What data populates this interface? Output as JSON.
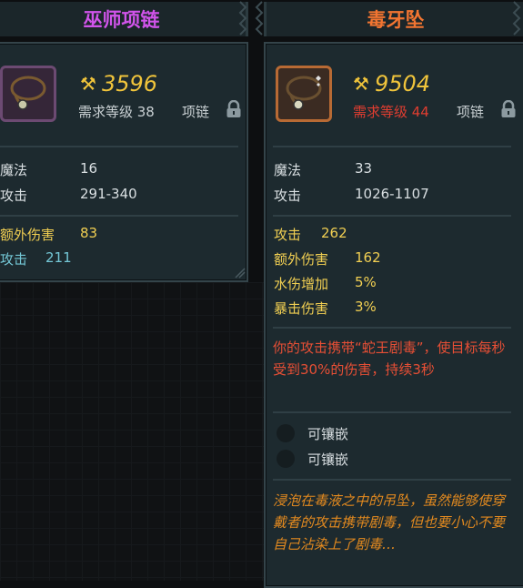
{
  "left_item": {
    "name": "巫师项链",
    "power": "3596",
    "requirement": "需求等级 38",
    "slot": "项链",
    "base_stats": [
      {
        "name": "魔法",
        "value": "16"
      },
      {
        "name": "攻击",
        "value": "291-340"
      }
    ],
    "bonus_stats": [
      {
        "name": "额外伤害",
        "value": "83",
        "color": "yellow"
      },
      {
        "name": "攻击",
        "value": "211",
        "color": "cyan"
      }
    ]
  },
  "right_item": {
    "name": "毒牙坠",
    "power": "9504",
    "requirement": "需求等级 44",
    "slot": "项链",
    "base_stats": [
      {
        "name": "魔法",
        "value": "33"
      },
      {
        "name": "攻击",
        "value": "1026-1107"
      }
    ],
    "bonus_stats": [
      {
        "name": "攻击",
        "value": "262"
      },
      {
        "name": "额外伤害",
        "value": "162"
      },
      {
        "name": "水伤增加",
        "value": "5%"
      },
      {
        "name": "暴击伤害",
        "value": "3%"
      }
    ],
    "effect": "你的攻击携带“蛇王剧毒”，使目标每秒受到30%的伤害，持续3秒",
    "sockets": [
      "可镶嵌",
      "可镶嵌"
    ],
    "flavor": "浸泡在毒液之中的吊坠，虽然能够使穿戴者的攻击携带剧毒，但也要小心不要自己沾染上了剧毒…"
  },
  "colors": {
    "left_title": "#d154ea",
    "right_title": "#f27531",
    "power": "#f0c43b",
    "requirement_unmet": "#e03d30",
    "bonus_yellow": "#f1cf52",
    "bonus_cyan": "#74c7d6",
    "effect": "#e84f35",
    "flavor": "#e38a1f"
  },
  "icons": {
    "power": "pickaxe-icon",
    "lock": "padlock-icon",
    "item": "necklace-icon"
  }
}
